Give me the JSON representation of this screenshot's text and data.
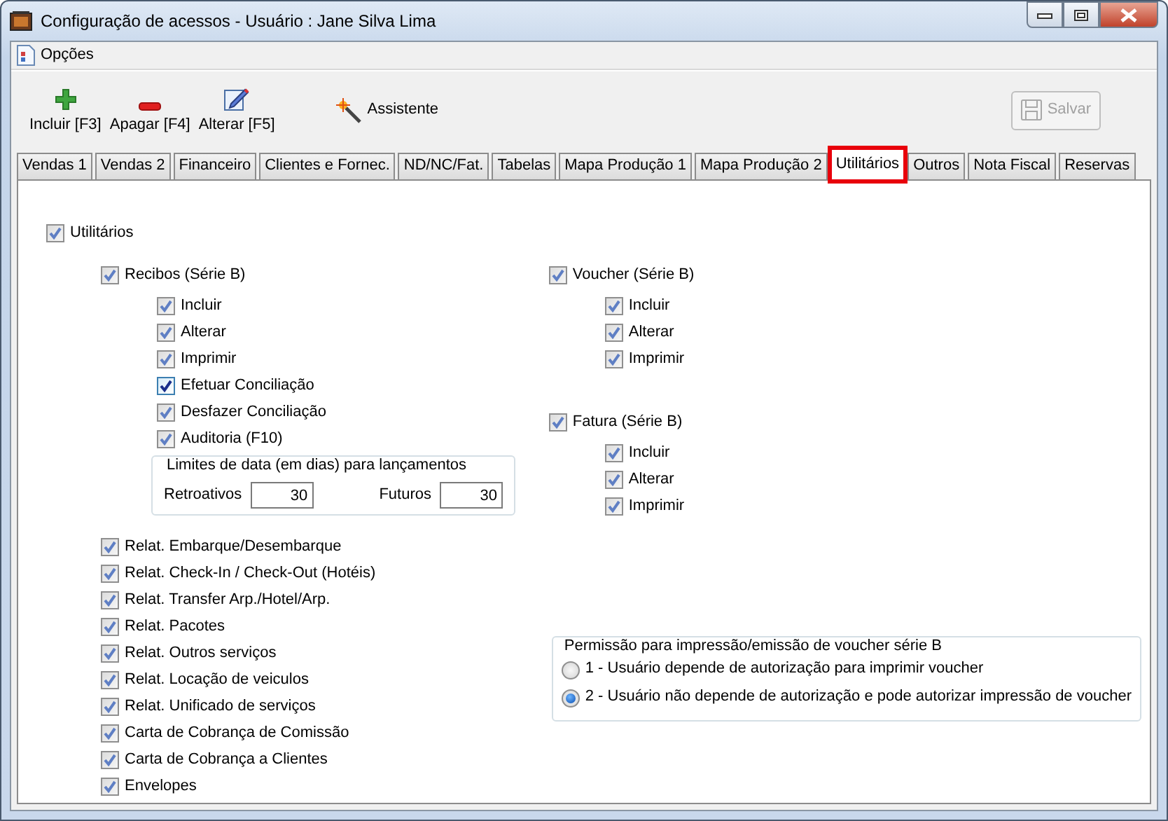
{
  "window": {
    "title": "Configuração de acessos - Usuário : Jane Silva Lima"
  },
  "menu": [
    {
      "label": "Opções"
    }
  ],
  "toolbar": [
    {
      "label": "Incluir [F3]",
      "kind": "add",
      "disabled": false
    },
    {
      "label": "Apagar [F4]",
      "kind": "delete",
      "disabled": false
    },
    {
      "label": "Alterar [F5]",
      "kind": "edit",
      "disabled": false
    },
    {
      "label": "Assistente",
      "kind": "wizard",
      "disabled": false
    },
    {
      "label": "Salvar",
      "kind": "save",
      "disabled": true
    }
  ],
  "tabs": [
    {
      "label": "Vendas 1",
      "selected": false,
      "marked": false
    },
    {
      "label": "Vendas 2",
      "selected": false,
      "marked": false
    },
    {
      "label": "Financeiro",
      "selected": false,
      "marked": false
    },
    {
      "label": "Clientes e Fornec.",
      "selected": false,
      "marked": false
    },
    {
      "label": "ND/NC/Fat.",
      "selected": false,
      "marked": false
    },
    {
      "label": "Tabelas",
      "selected": false,
      "marked": false
    },
    {
      "label": "Mapa Produção 1",
      "selected": false,
      "marked": false
    },
    {
      "label": "Mapa Produção 2",
      "selected": false,
      "marked": false
    },
    {
      "label": "Utilitários",
      "selected": true,
      "marked": true
    },
    {
      "label": "Outros",
      "selected": false,
      "marked": false
    },
    {
      "label": "Nota Fiscal",
      "selected": false,
      "marked": false
    },
    {
      "label": "Reservas",
      "selected": false,
      "marked": false
    }
  ],
  "master": {
    "label": "Utilitários",
    "checked": true,
    "hot": false
  },
  "recibos": {
    "label": "Recibos (Série B)",
    "checked": true,
    "hot": false,
    "items": [
      {
        "label": "Incluir",
        "checked": true,
        "hot": false
      },
      {
        "label": "Alterar",
        "checked": true,
        "hot": false
      },
      {
        "label": "Imprimir",
        "checked": true,
        "hot": false
      },
      {
        "label": "Efetuar Conciliação",
        "checked": true,
        "hot": true
      },
      {
        "label": "Desfazer Conciliação",
        "checked": true,
        "hot": false
      },
      {
        "label": "Auditoria (F10)",
        "checked": true,
        "hot": false
      }
    ],
    "date_limits": {
      "title": "Limites de data (em dias) para lançamentos",
      "fields": [
        {
          "label": "Retroativos",
          "value": "30"
        },
        {
          "label": "Futuros",
          "value": "30"
        }
      ]
    }
  },
  "reports": [
    {
      "label": "Relat. Embarque/Desembarque",
      "checked": true,
      "hot": false
    },
    {
      "label": "Relat. Check-In / Check-Out (Hotéis)",
      "checked": true,
      "hot": false
    },
    {
      "label": "Relat. Transfer Arp./Hotel/Arp.",
      "checked": true,
      "hot": false
    },
    {
      "label": "Relat. Pacotes",
      "checked": true,
      "hot": false
    },
    {
      "label": "Relat. Outros serviços",
      "checked": true,
      "hot": false
    },
    {
      "label": "Relat. Locação de veiculos",
      "checked": true,
      "hot": false
    },
    {
      "label": "Relat. Unificado de serviços",
      "checked": true,
      "hot": false
    },
    {
      "label": "Carta de Cobrança de Comissão",
      "checked": true,
      "hot": false
    },
    {
      "label": "Carta de Cobrança a Clientes",
      "checked": true,
      "hot": false
    },
    {
      "label": "Envelopes",
      "checked": true,
      "hot": false
    }
  ],
  "right_groups": [
    {
      "label": "Voucher (Série B)",
      "checked": true,
      "hot": false,
      "items": [
        {
          "label": "Incluir",
          "checked": true,
          "hot": false
        },
        {
          "label": "Alterar",
          "checked": true,
          "hot": false
        },
        {
          "label": "Imprimir",
          "checked": true,
          "hot": false
        }
      ]
    },
    {
      "label": "Fatura (Série B)",
      "checked": true,
      "hot": false,
      "items": [
        {
          "label": "Incluir",
          "checked": true,
          "hot": false
        },
        {
          "label": "Alterar",
          "checked": true,
          "hot": false
        },
        {
          "label": "Imprimir",
          "checked": true,
          "hot": false
        }
      ]
    }
  ],
  "permission": {
    "title": "Permissão para impressão/emissão de voucher série B",
    "options": [
      {
        "label": "1 - Usuário depende de autorização para imprimir voucher",
        "selected": false
      },
      {
        "label": "2 - Usuário não depende de autorização e pode autorizar impressão de voucher",
        "selected": true
      }
    ]
  }
}
